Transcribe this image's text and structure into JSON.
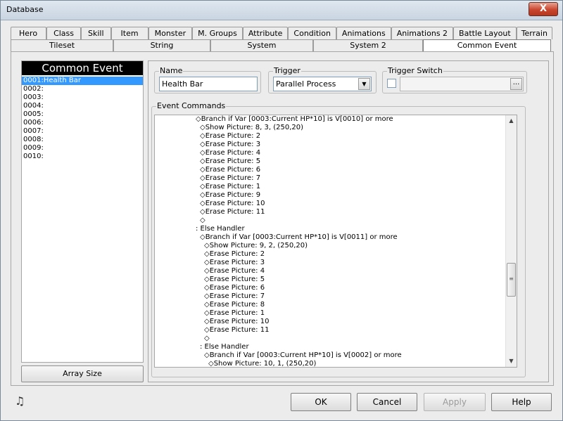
{
  "window": {
    "title": "Database",
    "close_label": "X"
  },
  "tabs_row1": [
    {
      "label": "Hero"
    },
    {
      "label": "Class"
    },
    {
      "label": "Skill"
    },
    {
      "label": "Item"
    },
    {
      "label": "Monster"
    },
    {
      "label": "M. Groups"
    },
    {
      "label": "Attribute"
    },
    {
      "label": "Condition"
    },
    {
      "label": "Animations"
    },
    {
      "label": "Animations 2"
    },
    {
      "label": "Battle Layout"
    },
    {
      "label": "Terrain"
    }
  ],
  "tabs_row2": [
    {
      "label": "Tileset"
    },
    {
      "label": "String"
    },
    {
      "label": "System"
    },
    {
      "label": "System 2"
    },
    {
      "label": "Common Event",
      "active": true
    }
  ],
  "event_list": {
    "header": "Common Event",
    "items": [
      "0001:Health Bar",
      "0002:",
      "0003:",
      "0004:",
      "0005:",
      "0006:",
      "0007:",
      "0008:",
      "0009:",
      "0010:"
    ],
    "array_size_label": "Array Size"
  },
  "name_group": {
    "label": "Name",
    "value": "Health Bar"
  },
  "trigger_group": {
    "label": "Trigger",
    "value": "Parallel Process"
  },
  "trigger_switch_group": {
    "label": "Trigger Switch",
    "dots_label": "..."
  },
  "event_commands": {
    "label": "Event Commands",
    "lines": [
      {
        "indent": 9,
        "text": "◇Branch if Var [0003:Current HP*10] is V[0010] or more"
      },
      {
        "indent": 10,
        "text": "◇Show Picture: 8, 3, (250,20)"
      },
      {
        "indent": 10,
        "text": "◇Erase Picture: 2"
      },
      {
        "indent": 10,
        "text": "◇Erase Picture: 3"
      },
      {
        "indent": 10,
        "text": "◇Erase Picture: 4"
      },
      {
        "indent": 10,
        "text": "◇Erase Picture: 5"
      },
      {
        "indent": 10,
        "text": "◇Erase Picture: 6"
      },
      {
        "indent": 10,
        "text": "◇Erase Picture: 7"
      },
      {
        "indent": 10,
        "text": "◇Erase Picture: 1"
      },
      {
        "indent": 10,
        "text": "◇Erase Picture: 9"
      },
      {
        "indent": 10,
        "text": "◇Erase Picture: 10"
      },
      {
        "indent": 10,
        "text": "◇Erase Picture: 11"
      },
      {
        "indent": 10,
        "text": "◇"
      },
      {
        "indent": 9,
        "text": ": Else Handler"
      },
      {
        "indent": 10,
        "text": "◇Branch if Var [0003:Current HP*10] is V[0011] or more"
      },
      {
        "indent": 11,
        "text": "◇Show Picture: 9, 2, (250,20)"
      },
      {
        "indent": 11,
        "text": "◇Erase Picture: 2"
      },
      {
        "indent": 11,
        "text": "◇Erase Picture: 3"
      },
      {
        "indent": 11,
        "text": "◇Erase Picture: 4"
      },
      {
        "indent": 11,
        "text": "◇Erase Picture: 5"
      },
      {
        "indent": 11,
        "text": "◇Erase Picture: 6"
      },
      {
        "indent": 11,
        "text": "◇Erase Picture: 7"
      },
      {
        "indent": 11,
        "text": "◇Erase Picture: 8"
      },
      {
        "indent": 11,
        "text": "◇Erase Picture: 1"
      },
      {
        "indent": 11,
        "text": "◇Erase Picture: 10"
      },
      {
        "indent": 11,
        "text": "◇Erase Picture: 11"
      },
      {
        "indent": 11,
        "text": "◇"
      },
      {
        "indent": 10,
        "text": ": Else Handler"
      },
      {
        "indent": 11,
        "text": "◇Branch if Var [0003:Current HP*10] is V[0002] or more"
      },
      {
        "indent": 12,
        "text": "◇Show Picture: 10, 1, (250,20)"
      }
    ]
  },
  "buttons": {
    "ok": "OK",
    "cancel": "Cancel",
    "apply": "Apply",
    "help": "Help"
  },
  "icons": {
    "music": "♫",
    "combo_arrow": "▼",
    "scroll_up": "▲",
    "scroll_down": "▼",
    "thumb_grip": "≡"
  }
}
